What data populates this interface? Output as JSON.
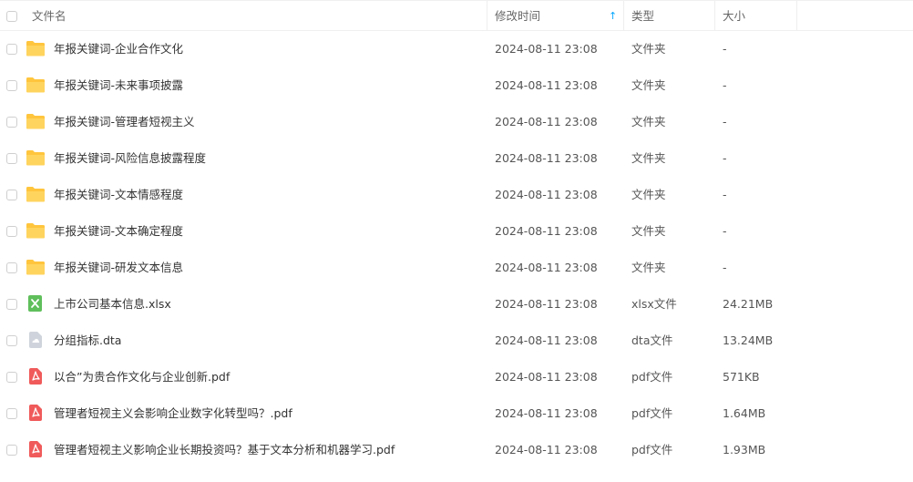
{
  "header": {
    "name_label": "文件名",
    "time_label": "修改时间",
    "sort_indicator": "↑",
    "type_label": "类型",
    "size_label": "大小"
  },
  "colors": {
    "folder": "#ffc53d",
    "xlsx": "#5fbf5b",
    "dta": "#cfd4dc",
    "pdf": "#f05a5a",
    "sort_accent": "#06a7ff"
  },
  "files": [
    {
      "name": "年报关键词-企业合作文化",
      "time": "2024-08-11 23:08",
      "type": "文件夹",
      "size": "-",
      "icon": "folder-icon"
    },
    {
      "name": "年报关键词-未来事项披露",
      "time": "2024-08-11 23:08",
      "type": "文件夹",
      "size": "-",
      "icon": "folder-icon"
    },
    {
      "name": "年报关键词-管理者短视主义",
      "time": "2024-08-11 23:08",
      "type": "文件夹",
      "size": "-",
      "icon": "folder-icon"
    },
    {
      "name": "年报关键词-风险信息披露程度",
      "time": "2024-08-11 23:08",
      "type": "文件夹",
      "size": "-",
      "icon": "folder-icon"
    },
    {
      "name": "年报关键词-文本情感程度",
      "time": "2024-08-11 23:08",
      "type": "文件夹",
      "size": "-",
      "icon": "folder-icon"
    },
    {
      "name": "年报关键词-文本确定程度",
      "time": "2024-08-11 23:08",
      "type": "文件夹",
      "size": "-",
      "icon": "folder-icon"
    },
    {
      "name": "年报关键词-研发文本信息",
      "time": "2024-08-11 23:08",
      "type": "文件夹",
      "size": "-",
      "icon": "folder-icon"
    },
    {
      "name": "上市公司基本信息.xlsx",
      "time": "2024-08-11 23:08",
      "type": "xlsx文件",
      "size": "24.21MB",
      "icon": "xlsx-file-icon"
    },
    {
      "name": "分组指标.dta",
      "time": "2024-08-11 23:08",
      "type": "dta文件",
      "size": "13.24MB",
      "icon": "dta-file-icon"
    },
    {
      "name": "以合”为贵合作文化与企业创新.pdf",
      "time": "2024-08-11 23:08",
      "type": "pdf文件",
      "size": "571KB",
      "icon": "pdf-file-icon"
    },
    {
      "name": "管理者短视主义会影响企业数字化转型吗？.pdf",
      "time": "2024-08-11 23:08",
      "type": "pdf文件",
      "size": "1.64MB",
      "icon": "pdf-file-icon"
    },
    {
      "name": "管理者短视主义影响企业长期投资吗？基于文本分析和机器学习.pdf",
      "time": "2024-08-11 23:08",
      "type": "pdf文件",
      "size": "1.93MB",
      "icon": "pdf-file-icon"
    }
  ]
}
